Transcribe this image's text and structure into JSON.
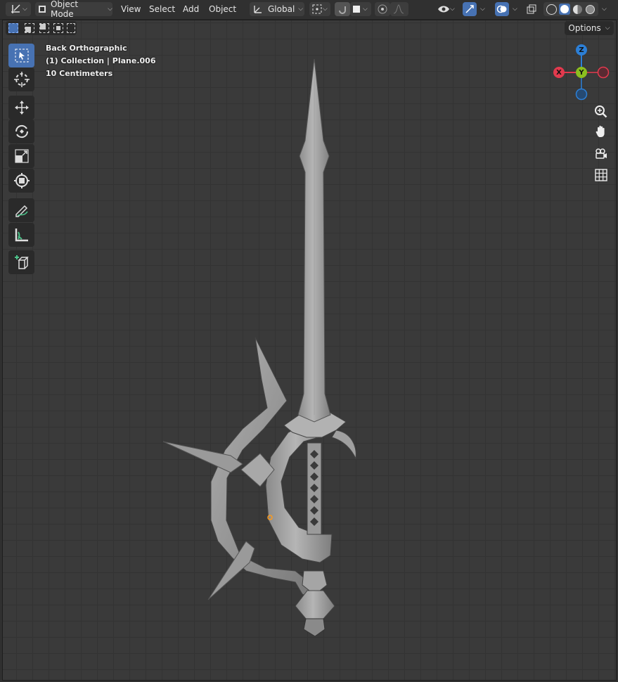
{
  "header": {
    "mode_label": "Object Mode",
    "menus": [
      "View",
      "Select",
      "Add",
      "Object"
    ],
    "orientation_label": "Global"
  },
  "toolbar_row": {
    "options_label": "Options"
  },
  "viewport": {
    "view_name": "Back Orthographic",
    "collection_info": "(1) Collection | Plane.006",
    "scale_label": "10 Centimeters"
  },
  "gizmo": {
    "x_label": "X",
    "y_label": "Y",
    "z_label": "Z",
    "colors": {
      "x": "#e23a4e",
      "y": "#8bbf1f",
      "z": "#2c7fd6"
    }
  },
  "tools": [
    "select-box",
    "cursor",
    "move",
    "rotate",
    "scale",
    "transform",
    "annotate",
    "measure",
    "add-cube"
  ],
  "nav_buttons": [
    "zoom",
    "pan",
    "camera",
    "grid"
  ]
}
